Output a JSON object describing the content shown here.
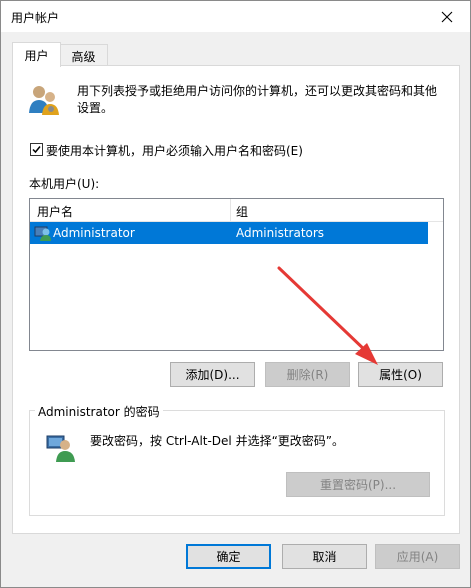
{
  "window": {
    "title": "用户帐户"
  },
  "tabs": [
    {
      "label": "用户"
    },
    {
      "label": "高级"
    }
  ],
  "users_tab": {
    "description": "用下列表授予或拒绝用户访问你的计算机，还可以更改其密码和其他设置。",
    "require_login_checkbox": {
      "label": "要使用本计算机，用户必须输入用户名和密码(E)",
      "checked": true
    },
    "local_users_label": "本机用户(U):",
    "table": {
      "columns": [
        "用户名",
        "组"
      ],
      "rows": [
        {
          "user": "Administrator",
          "group": "Administrators",
          "selected": true
        }
      ]
    },
    "buttons": {
      "add": "添加(D)...",
      "remove": "删除(R)",
      "properties": "属性(O)"
    },
    "password_group": {
      "title": "Administrator 的密码",
      "text": "要改密码，按 Ctrl-Alt-Del 并选择“更改密码”。",
      "reset_button": "重置密码(P)..."
    }
  },
  "dialog_buttons": {
    "ok": "确定",
    "cancel": "取消",
    "apply": "应用(A)"
  },
  "colors": {
    "selection": "#0078d7",
    "arrow": "#e53935"
  }
}
